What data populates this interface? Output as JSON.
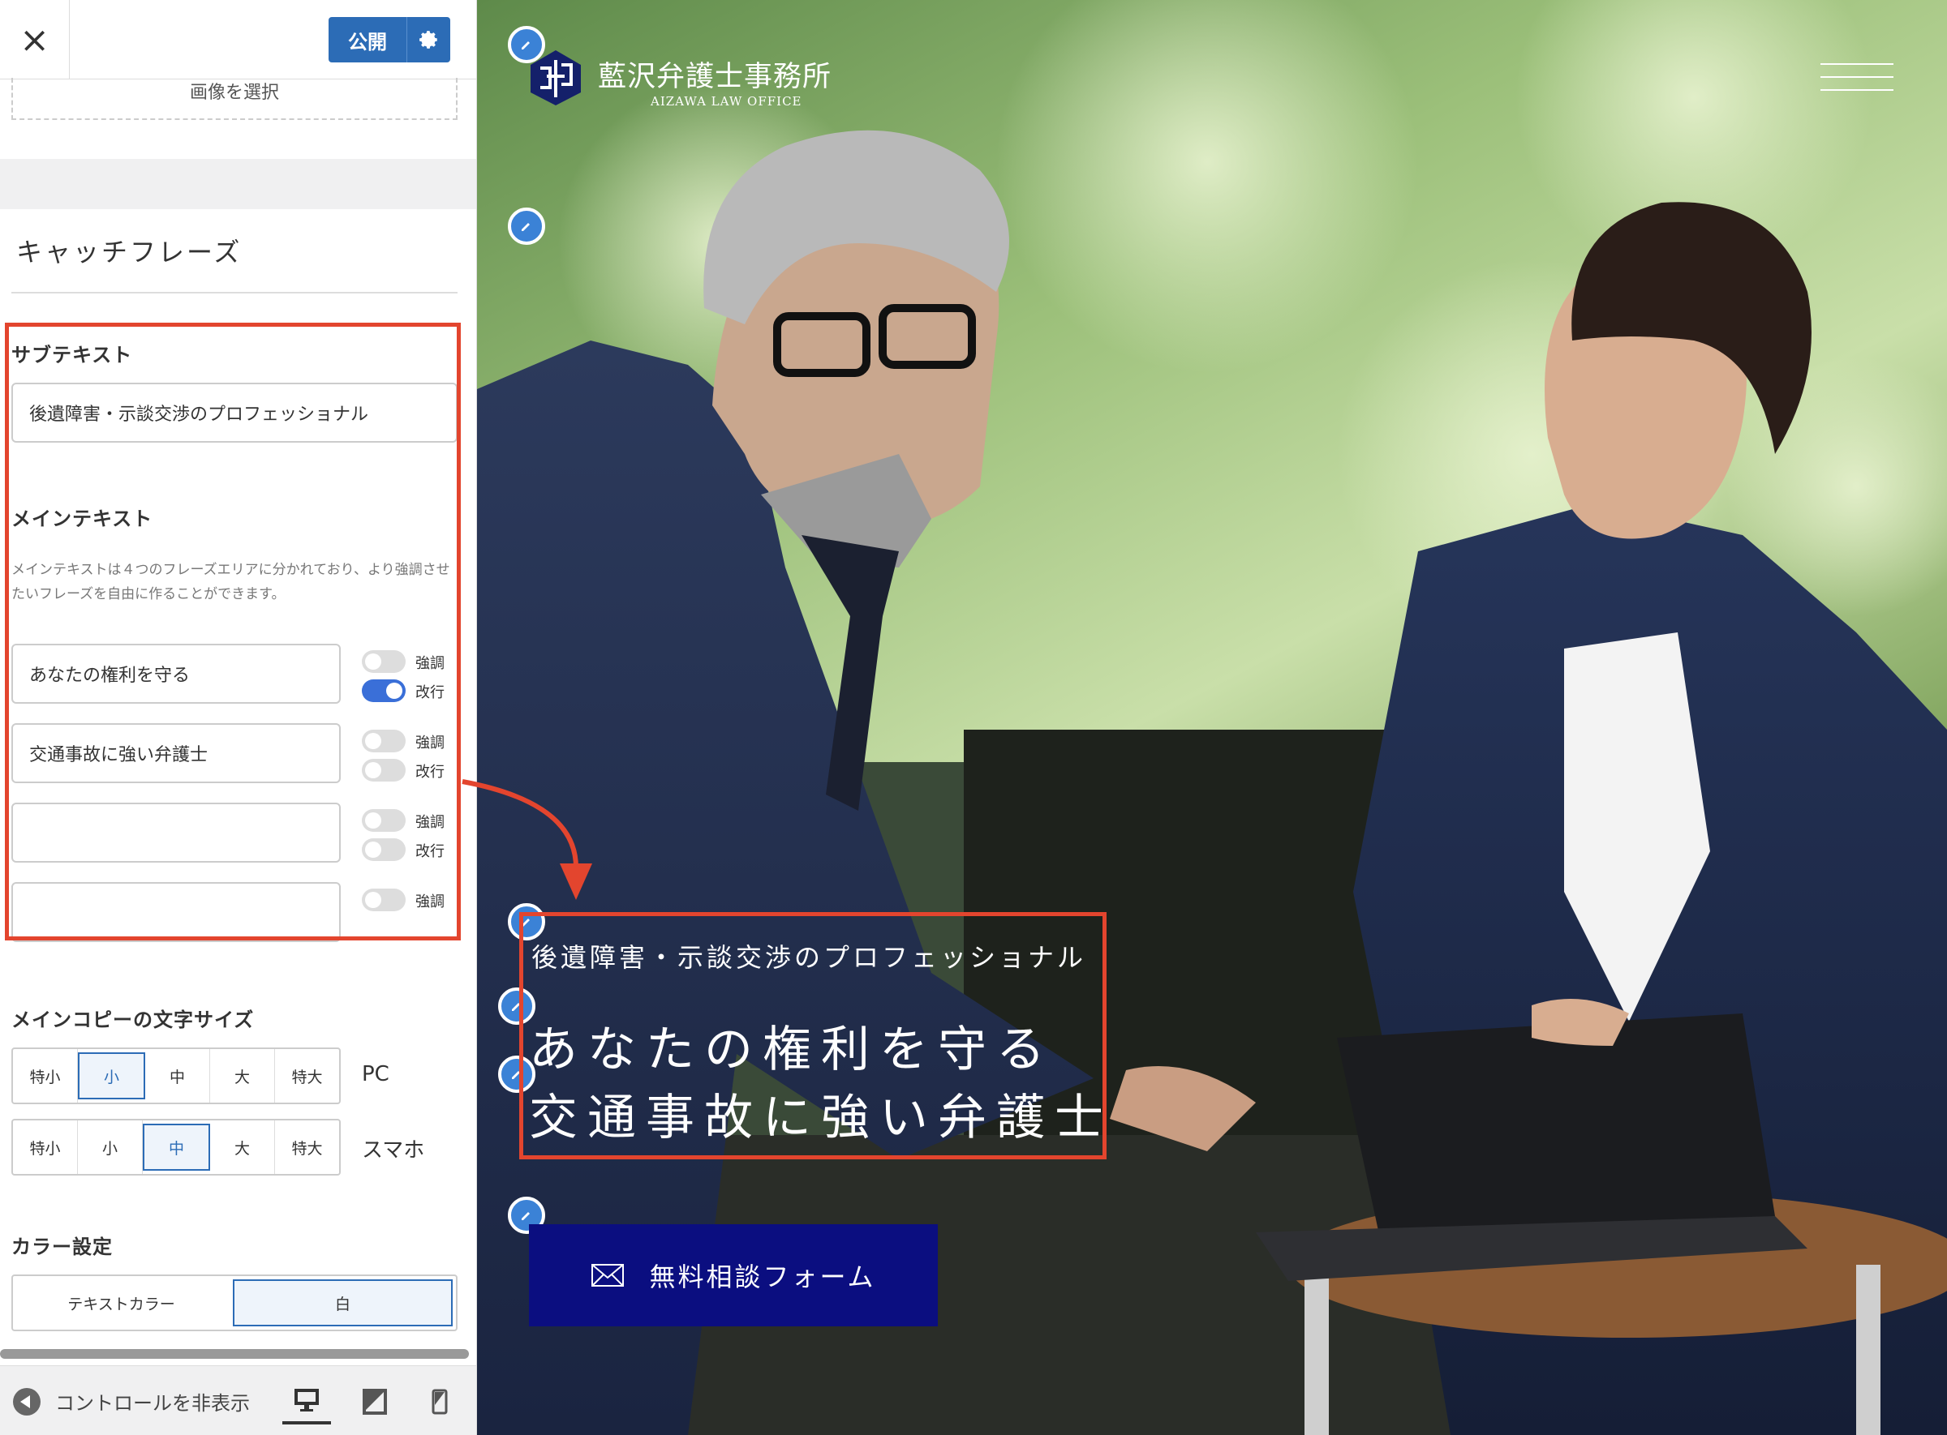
{
  "topbar": {
    "close_glyph": "×",
    "publish_label": "公開",
    "settings_icon": "gear-icon"
  },
  "image_select_label": "画像を選択",
  "section_title": "キャッチフレーズ",
  "subtext": {
    "label": "サブテキスト",
    "value": "後遺障害・示談交渉のプロフェッショナル"
  },
  "maintext": {
    "label": "メインテキスト",
    "description": "メインテキストは４つのフレーズエリアに分かれており、より強調させたいフレーズを自由に作ることができます。",
    "phrases": [
      {
        "value": "あなたの権利を守る",
        "emphasis_label": "強調",
        "linebreak_label": "改行",
        "emphasis": false,
        "linebreak": true
      },
      {
        "value": "交通事故に強い弁護士",
        "emphasis_label": "強調",
        "linebreak_label": "改行",
        "emphasis": false,
        "linebreak": false
      },
      {
        "value": "",
        "emphasis_label": "強調",
        "linebreak_label": "改行",
        "emphasis": false,
        "linebreak": false
      },
      {
        "value": "",
        "emphasis_label": "強調",
        "emphasis": false
      }
    ]
  },
  "font_size": {
    "label": "メインコピーの文字サイズ",
    "options": [
      "特小",
      "小",
      "中",
      "大",
      "特大"
    ],
    "pc_label": "PC",
    "pc_selected": "小",
    "sp_label": "スマホ",
    "sp_selected": "中"
  },
  "color": {
    "label": "カラー設定",
    "text_color_label": "テキストカラー",
    "value": "白"
  },
  "footer": {
    "hide_controls_label": "コントロールを非表示",
    "devices": [
      "desktop-icon",
      "tablet-icon",
      "mobile-icon"
    ],
    "selected_device": "desktop-icon"
  },
  "preview": {
    "logo_jp": "藍沢弁護士事務所",
    "logo_en": "AIZAWA LAW OFFICE",
    "sub_text": "後遺障害・示談交渉のプロフェッショナル",
    "main_line1": "あなたの権利を守る",
    "main_line2": "交通事故に強い弁護士",
    "cta_label": "無料相談フォーム",
    "cta_icon": "envelope-icon"
  },
  "colors": {
    "accent_blue": "#2c6cb6",
    "annotation_red": "#e3452e",
    "cta_navy": "#0b0e80"
  }
}
